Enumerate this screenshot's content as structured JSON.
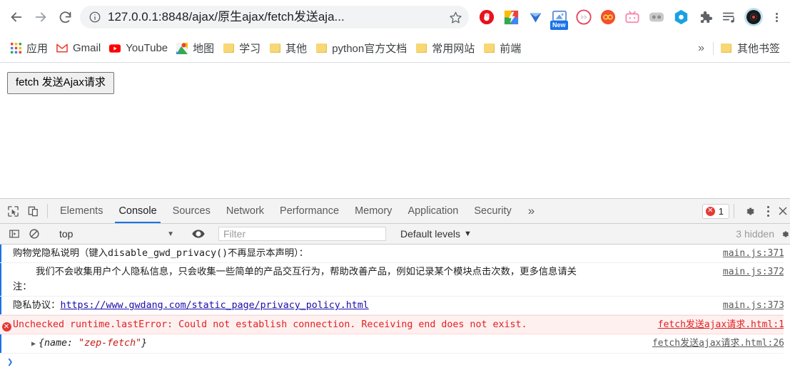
{
  "browser": {
    "nav": {
      "back_label": "Back",
      "forward_label": "Forward",
      "reload_label": "Reload"
    },
    "omnibox": {
      "info_icon": "info-circle-icon",
      "url_text": "127.0.0.1:8848/ajax/原生ajax/fetch发送aja...",
      "star_icon": "bookmark-star-icon"
    },
    "extensions": [
      {
        "name": "adblock-extension-icon",
        "badge": ""
      },
      {
        "name": "colorful-square-extension-icon",
        "badge": ""
      },
      {
        "name": "blue-diamond-extension-icon",
        "badge": ""
      },
      {
        "name": "screenshot-extension-icon",
        "badge": "New"
      },
      {
        "name": "fast-forward-extension-icon",
        "badge": ""
      },
      {
        "name": "infinity-extension-icon",
        "badge": ""
      },
      {
        "name": "pink-tv-extension-icon",
        "badge": ""
      },
      {
        "name": "gray-capsule-extension-icon",
        "badge": ""
      },
      {
        "name": "blue-hexagon-extension-icon",
        "badge": ""
      },
      {
        "name": "puzzle-extensions-icon",
        "badge": ""
      },
      {
        "name": "playlist-music-icon",
        "badge": ""
      },
      {
        "name": "vinyl-record-profile-icon",
        "badge": ""
      }
    ],
    "menu_icon": "browser-menu-kebab-icon"
  },
  "bookmarks": {
    "items": [
      {
        "label": "应用",
        "icon": "apps-grid-icon"
      },
      {
        "label": "Gmail",
        "icon": "gmail-icon"
      },
      {
        "label": "YouTube",
        "icon": "youtube-icon"
      },
      {
        "label": "地图",
        "icon": "google-maps-icon"
      },
      {
        "label": "学习",
        "icon": "folder-icon"
      },
      {
        "label": "其他",
        "icon": "folder-icon"
      },
      {
        "label": "python官方文档",
        "icon": "folder-icon"
      },
      {
        "label": "常用网站",
        "icon": "folder-icon"
      },
      {
        "label": "前端",
        "icon": "folder-icon"
      }
    ],
    "overflow_label": "»",
    "other_bookmarks": {
      "label": "其他书签",
      "icon": "folder-icon"
    }
  },
  "page": {
    "button_label": "fetch 发送Ajax请求"
  },
  "devtools": {
    "inspect_icon": "inspect-element-icon",
    "device_toggle_icon": "device-toolbar-icon",
    "tabs": [
      {
        "label": "Elements",
        "active": false
      },
      {
        "label": "Console",
        "active": true
      },
      {
        "label": "Sources",
        "active": false
      },
      {
        "label": "Network",
        "active": false
      },
      {
        "label": "Performance",
        "active": false
      },
      {
        "label": "Memory",
        "active": false
      },
      {
        "label": "Application",
        "active": false
      },
      {
        "label": "Security",
        "active": false
      }
    ],
    "more_tabs_label": "»",
    "error_count": "1",
    "error_badge_glyph": "✕",
    "settings_icon": "gear-icon",
    "menu_icon": "devtools-kebab-icon",
    "close_icon": "close-icon",
    "console_toolbar": {
      "clear_icon": "no-entry-clear-console-icon",
      "sidebar_icon": "console-sidebar-icon",
      "context_value": "top",
      "context_caret": "▼",
      "eye_icon": "live-expression-eye-icon",
      "filter_placeholder": "Filter",
      "filter_value": "",
      "levels_label": "Default levels",
      "levels_caret": "▼",
      "hidden_label": "3 hidden",
      "settings_icon": "console-settings-icon"
    },
    "console_messages": [
      {
        "kind": "log",
        "text": "购物党隐私说明（键入disable_gwd_privacy()不再显示本声明）：",
        "source": "main.js:371"
      },
      {
        "kind": "log",
        "text": "    我们不会收集用户个人隐私信息，只会收集一些简单的产品交互行为，帮助改善产品，例如记录某个模块点击次数，更多信息请关\n注：",
        "source": "main.js:372"
      },
      {
        "kind": "log-link",
        "text_before": "隐私协议：",
        "link_text": "https://www.gwdang.com/static_page/privacy_policy.html",
        "source": "main.js:373"
      },
      {
        "kind": "error",
        "icon": "error-circle-icon",
        "text": "Unchecked runtime.lastError: Could not establish connection. Receiving end does not exist.",
        "source": "fetch发送ajax请求.html:1"
      },
      {
        "kind": "object",
        "arrow": "▶",
        "obj_prefix": "{name: ",
        "obj_string": "\"zep-fetch\"",
        "obj_suffix": "}",
        "source": "fetch发送ajax请求.html:26"
      }
    ],
    "prompt_caret": "❯"
  },
  "colors": {
    "accent_blue": "#1a73e8",
    "error_red": "#e02020",
    "link_blue": "#1a0dab",
    "string_red": "#c41a16",
    "toolbar_bg": "#f3f3f3"
  }
}
